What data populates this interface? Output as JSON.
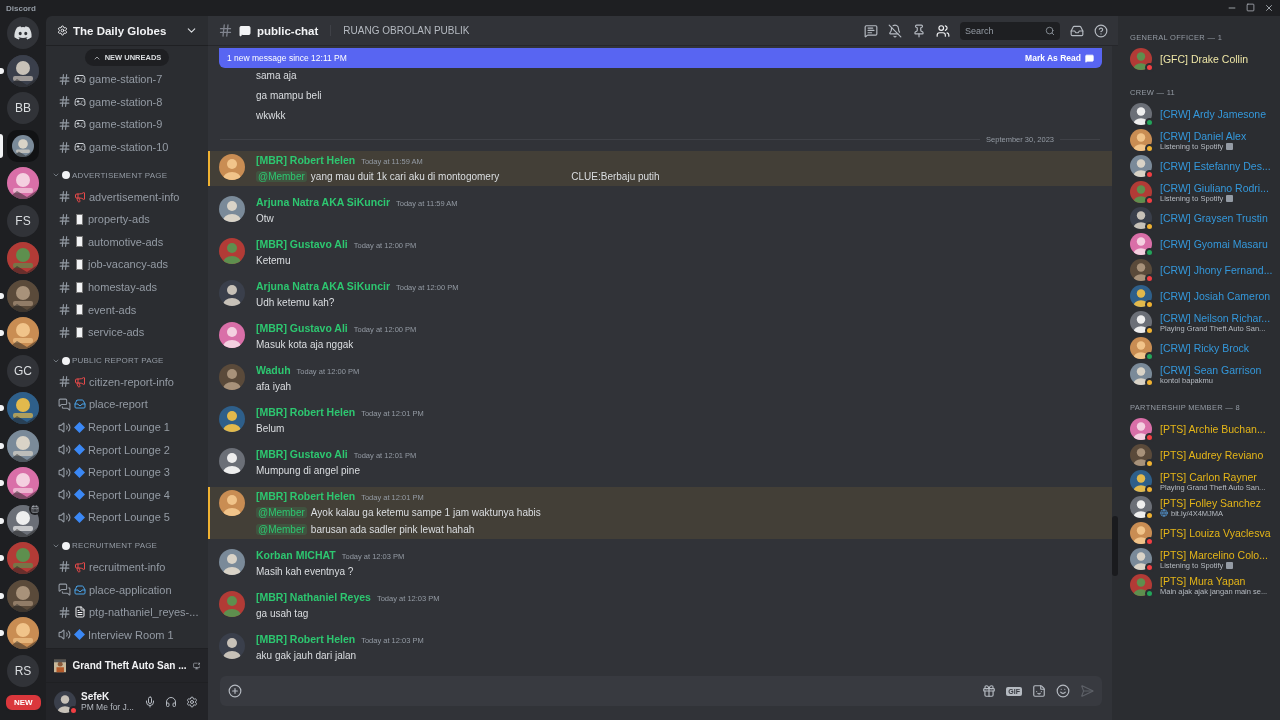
{
  "window": {
    "title": "Discord"
  },
  "servers": [
    {
      "kind": "home",
      "selected": false,
      "unread": false,
      "event": false
    },
    {
      "kind": "picture",
      "selected": false,
      "unread": true,
      "event": false
    },
    {
      "kind": "initials",
      "label": "BB",
      "selected": false,
      "unread": false,
      "event": false
    },
    {
      "kind": "picture",
      "selected": true,
      "unread": false,
      "event": false
    },
    {
      "kind": "picture",
      "selected": false,
      "unread": false,
      "event": false
    },
    {
      "kind": "initials",
      "label": "FS",
      "selected": false,
      "unread": false,
      "event": false
    },
    {
      "kind": "picture",
      "selected": false,
      "unread": false,
      "event": false
    },
    {
      "kind": "picture",
      "selected": false,
      "unread": true,
      "event": false
    },
    {
      "kind": "picture",
      "selected": false,
      "unread": true,
      "event": false
    },
    {
      "kind": "initials",
      "label": "GC",
      "selected": false,
      "unread": false,
      "event": false
    },
    {
      "kind": "picture",
      "selected": false,
      "unread": true,
      "event": false
    },
    {
      "kind": "picture",
      "selected": false,
      "unread": true,
      "event": false
    },
    {
      "kind": "picture",
      "selected": false,
      "unread": true,
      "event": false
    },
    {
      "kind": "picture",
      "selected": false,
      "unread": true,
      "event": true
    },
    {
      "kind": "picture",
      "selected": false,
      "unread": true,
      "event": false
    },
    {
      "kind": "picture",
      "selected": false,
      "unread": true,
      "event": false
    },
    {
      "kind": "picture",
      "selected": false,
      "unread": true,
      "event": false
    },
    {
      "kind": "initials",
      "label": "RS",
      "selected": false,
      "unread": false,
      "event": false
    }
  ],
  "new_pill": "NEW",
  "server_name": "The Daily Globes",
  "new_unreads": "NEW UNREADS",
  "channels": [
    {
      "kind": "gamepad",
      "name": "game-station-7"
    },
    {
      "kind": "gamepad",
      "name": "game-station-8"
    },
    {
      "kind": "gamepad",
      "name": "game-station-9"
    },
    {
      "kind": "gamepad",
      "name": "game-station-10"
    }
  ],
  "categories": [
    {
      "name": "ADVERTISEMENT PAGE",
      "channels": [
        {
          "kind": "announcement",
          "name": "advertisement-info"
        },
        {
          "kind": "listing",
          "name": "property-ads"
        },
        {
          "kind": "listing",
          "name": "automotive-ads"
        },
        {
          "kind": "listing",
          "name": "job-vacancy-ads"
        },
        {
          "kind": "listing",
          "name": "homestay-ads"
        },
        {
          "kind": "listing",
          "name": "event-ads"
        },
        {
          "kind": "listing",
          "name": "service-ads"
        }
      ]
    },
    {
      "name": "PUBLIC REPORT PAGE",
      "channels": [
        {
          "kind": "announcement",
          "name": "citizen-report-info"
        },
        {
          "kind": "forum",
          "name": "place-report"
        },
        {
          "kind": "voice",
          "name": "Report Lounge 1"
        },
        {
          "kind": "voice",
          "name": "Report Lounge 2"
        },
        {
          "kind": "voice",
          "name": "Report Lounge 3"
        },
        {
          "kind": "voice",
          "name": "Report Lounge 4"
        },
        {
          "kind": "voice",
          "name": "Report Lounge 5"
        }
      ]
    },
    {
      "name": "RECRUITMENT PAGE",
      "channels": [
        {
          "kind": "announcement",
          "name": "recruitment-info"
        },
        {
          "kind": "forum",
          "name": "place-application"
        },
        {
          "kind": "document",
          "name": "ptg-nathaniel_reyes-..."
        },
        {
          "kind": "voice",
          "name": "Interview Room 1"
        }
      ]
    }
  ],
  "activity": {
    "title": "Grand Theft Auto San ..."
  },
  "user": {
    "name": "SefeK",
    "status_text": "PM Me for J...",
    "color": "#f23f43"
  },
  "header": {
    "channel": "public-chat",
    "topic": "RUANG OBROLAN PUBLIK",
    "search_placeholder": "Search"
  },
  "banner": {
    "text": "1 new message since 12:11 PM",
    "action": "Mark As Read"
  },
  "messages": [
    {
      "kind": "continuation",
      "lines": [
        {
          "text": "sama aja"
        },
        {
          "text": "ga mampu beli"
        },
        {
          "text": "wkwkk"
        }
      ]
    },
    {
      "kind": "divider",
      "text": "September 30, 2023"
    },
    {
      "kind": "message",
      "author": "[MBR] Robert Helen",
      "time": "Today at 11:59 AM",
      "highlighted": true,
      "lines": [
        {
          "mention": "@Member",
          "text": "yang mau duit 1k cari aku di montogomery",
          "aside": "CLUE:Berbaju putih"
        }
      ]
    },
    {
      "kind": "message",
      "author": "Arjuna Natra AKA SiKuncir",
      "time": "Today at 11:59 AM",
      "highlighted": false,
      "lines": [
        {
          "text": "Otw"
        }
      ]
    },
    {
      "kind": "message",
      "author": "[MBR] Gustavo Ali",
      "time": "Today at 12:00 PM",
      "highlighted": false,
      "lines": [
        {
          "text": "Ketemu"
        }
      ]
    },
    {
      "kind": "message",
      "author": "Arjuna Natra AKA SiKuncir",
      "time": "Today at 12:00 PM",
      "highlighted": false,
      "lines": [
        {
          "text": "Udh ketemu kah?"
        }
      ]
    },
    {
      "kind": "message",
      "author": "[MBR] Gustavo Ali",
      "time": "Today at 12:00 PM",
      "highlighted": false,
      "lines": [
        {
          "text": "Masuk kota aja nggak"
        }
      ]
    },
    {
      "kind": "message",
      "author": "Waduh",
      "time": "Today at 12:00 PM",
      "highlighted": false,
      "lines": [
        {
          "text": "afa iyah"
        }
      ]
    },
    {
      "kind": "message",
      "author": "[MBR] Robert Helen",
      "time": "Today at 12:01 PM",
      "highlighted": false,
      "lines": [
        {
          "text": "Belum"
        }
      ]
    },
    {
      "kind": "message",
      "author": "[MBR] Gustavo Ali",
      "time": "Today at 12:01 PM",
      "highlighted": false,
      "lines": [
        {
          "text": "Mumpung di angel pine"
        }
      ]
    },
    {
      "kind": "message",
      "author": "[MBR] Robert Helen",
      "time": "Today at 12:01 PM",
      "highlighted": true,
      "lines": [
        {
          "mention": "@Member",
          "text": "Ayok kalau ga ketemu sampe 1 jam waktunya habis"
        },
        {
          "mention": "@Member",
          "text": "barusan ada sadler pink lewat hahah"
        }
      ]
    },
    {
      "kind": "message",
      "author": "Korban MICHAT",
      "time": "Today at 12:03 PM",
      "highlighted": false,
      "lines": [
        {
          "text": "Masih kah eventnya ?"
        }
      ]
    },
    {
      "kind": "message",
      "author": "[MBR] Nathaniel Reyes",
      "time": "Today at 12:03 PM",
      "highlighted": false,
      "lines": [
        {
          "text": "ga usah tag"
        }
      ]
    },
    {
      "kind": "message",
      "author": "[MBR] Robert Helen",
      "time": "Today at 12:03 PM",
      "highlighted": false,
      "lines": [
        {
          "text": "aku gak jauh dari jalan"
        }
      ]
    }
  ],
  "composer": {
    "gif_label": "GIF"
  },
  "member_groups": [
    {
      "title": "GENERAL OFFICER — 1",
      "color": "#eee6a6",
      "members": [
        {
          "name": "[GFC] Drake Collin",
          "color": "#f23f43"
        }
      ]
    },
    {
      "title": "CREW — 11",
      "color": "#3498db",
      "members": [
        {
          "name": "[CRW] Ardy Jamesone",
          "color": "#23a55a"
        },
        {
          "name": "[CRW] Daniel Alex",
          "color": "#f0b232",
          "activity": {
            "kind": "listening",
            "text": "Listening to Spotify"
          }
        },
        {
          "name": "[CRW] Estefanny Des...",
          "color": "#f23f43"
        },
        {
          "name": "[CRW] Giuliano Rodri...",
          "color": "#f23f43",
          "activity": {
            "kind": "listening",
            "text": "Listening to Spotify"
          }
        },
        {
          "name": "[CRW] Graysen Trustin",
          "color": "#f0b232"
        },
        {
          "name": "[CRW] Gyomai Masaru",
          "color": "#23a55a"
        },
        {
          "name": "[CRW] Jhony Fernand...",
          "color": "#f23f43"
        },
        {
          "name": "[CRW] Josiah Cameron",
          "color": "#f0b232"
        },
        {
          "name": "[CRW] Neilson Richar...",
          "color": "#f0b232",
          "activity": {
            "kind": "playing",
            "text": "Playing Grand Theft Auto San..."
          }
        },
        {
          "name": "[CRW] Ricky Brock",
          "color": "#23a55a"
        },
        {
          "name": "[CRW] Sean Garrison",
          "color": "#f0b232",
          "activity": {
            "kind": "custom",
            "text": "kontol bapakmu"
          }
        }
      ]
    },
    {
      "title": "PARTNERSHIP MEMBER — 8",
      "color": "#e5b618",
      "members": [
        {
          "name": "[PTS] Archie Buchan...",
          "color": "#f23f43"
        },
        {
          "name": "[PTS] Audrey Reviano",
          "color": "#f0b232"
        },
        {
          "name": "[PTS] Carlon Rayner",
          "color": "#f0b232",
          "activity": {
            "kind": "playing",
            "text": "Playing Grand Theft Auto San..."
          }
        },
        {
          "name": "[PTS] Folley Sanchez",
          "color": "#f0b232",
          "activity": {
            "kind": "link",
            "text": "bit.ly/4X4MJMA"
          }
        },
        {
          "name": "[PTS] Louiza Vyaclesva",
          "color": "#f23f43"
        },
        {
          "name": "[PTS] Marcelino Colo...",
          "color": "#f23f43",
          "activity": {
            "kind": "listening",
            "text": "Listening to Spotify"
          }
        },
        {
          "name": "[PTS] Mura Yapan",
          "color": "#23a55a",
          "activity": {
            "kind": "custom",
            "text": "Main ajak ajak jangan main se..."
          }
        }
      ]
    }
  ]
}
